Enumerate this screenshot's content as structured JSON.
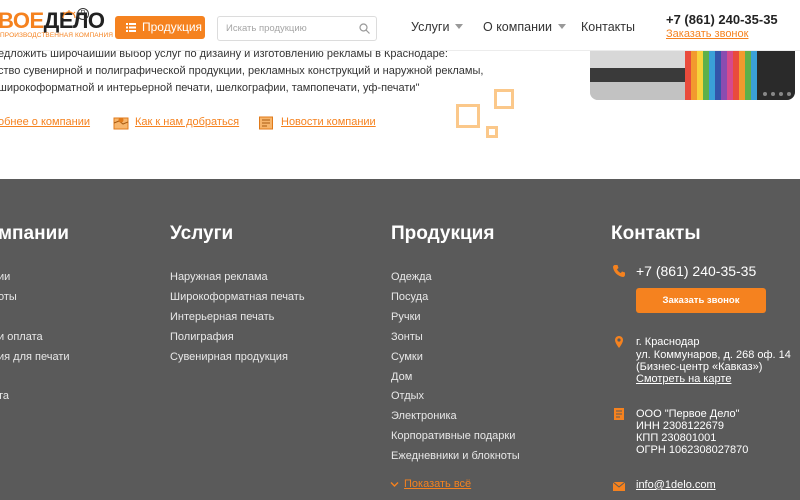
{
  "header": {
    "logo_part1": "ВОЕ",
    "logo_part2": "ДЕЛО",
    "logo_tagline": "ПРОИЗВОДСТВЕННАЯ КОМПАНИЯ",
    "logo_reg": "R",
    "products_button": "Продукция",
    "search_placeholder": "Искать продукцию",
    "nav": [
      {
        "label": "Услуги"
      },
      {
        "label": "О компании"
      },
      {
        "label": "Контакты"
      }
    ],
    "phone": "+7 (861) 240-35-35",
    "callback": "Заказать звонок"
  },
  "intro": {
    "lines": [
      "едложить широчайший выбор услуг по дизайну и изготовлению рекламы в Краснодаре:",
      "ство сувенирной и полиграфической продукции, рекламных конструкций и наружной рекламы,",
      "широкоформатной и интерьерной печати, шелкографии, тампопечати, уф-печати\""
    ],
    "links": [
      {
        "label": "обнее о компании"
      },
      {
        "label": "Как к нам добраться"
      },
      {
        "label": "Новости компании"
      }
    ]
  },
  "footer": {
    "company": {
      "heading": "мпании",
      "items": [
        "ии",
        "оты",
        "и оплата",
        "ия для печати",
        "та"
      ]
    },
    "services": {
      "heading": "Услуги",
      "items": [
        "Наружная реклама",
        "Широкоформатная печать",
        "Интерьерная печать",
        "Полиграфия",
        "Сувенирная продукция"
      ]
    },
    "products": {
      "heading": "Продукция",
      "items": [
        "Одежда",
        "Посуда",
        "Ручки",
        "Зонты",
        "Сумки",
        "Дом",
        "Отдых",
        "Электроника",
        "Корпоративные подарки",
        "Ежедневники и блокноты"
      ],
      "show_all": "Показать всё"
    },
    "contacts": {
      "heading": "Контакты",
      "phone": "+7 (861) 240-35-35",
      "callback_button": "Заказать звонок",
      "address": [
        "г. Краснодар",
        "ул. Коммунаров, д. 268 оф. 14",
        "(Бизнес-центр «Кавказ»)"
      ],
      "map_link": "Смотреть на карте",
      "legal": [
        "ООО \"Первое Дело\"",
        "ИНН 2308122679",
        "КПП 230801001",
        "ОГРН 1062308027870"
      ],
      "email": "info@1delo.com"
    }
  },
  "colors": {
    "accent": "#f5821f",
    "footer_bg": "#5a5a5a"
  }
}
